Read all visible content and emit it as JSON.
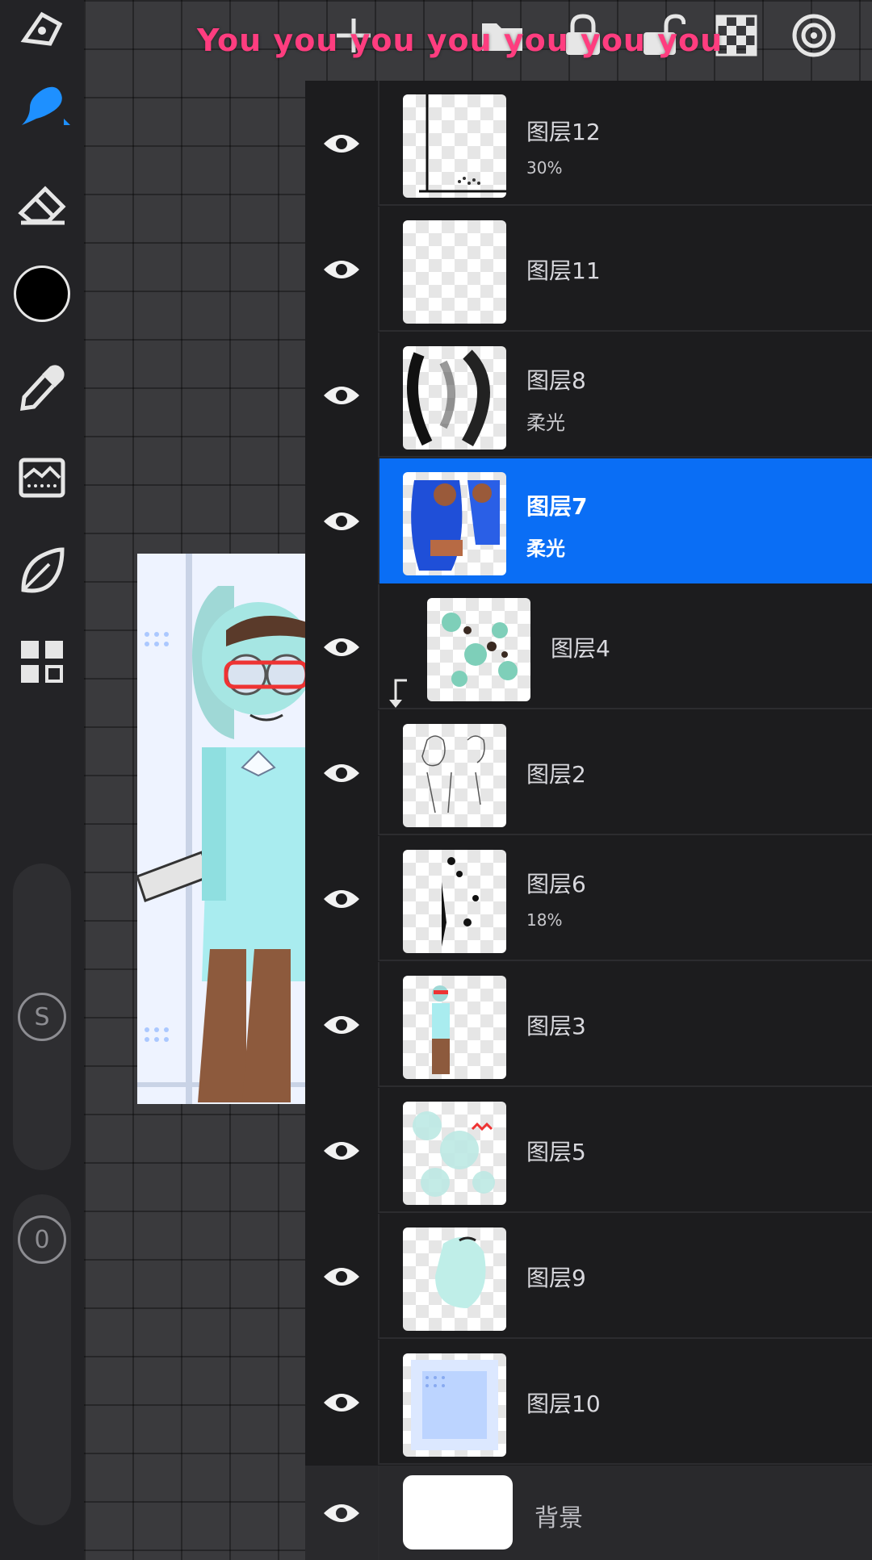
{
  "banner": {
    "text": "You you you you you you you"
  },
  "toolbar": {
    "tools": [
      "gallery-icon",
      "brush-icon",
      "eraser-icon",
      "color-swatch",
      "eyedropper-icon",
      "adjustments-icon",
      "smudge-leaf-icon",
      "layers-icon"
    ],
    "color": "#000000",
    "size_knob_label": "S",
    "opacity_knob_label": "0"
  },
  "top_actions": [
    "add-layer-icon",
    "folder-icon",
    "lock-icon",
    "unlock-icon",
    "checkerboard-icon",
    "target-icon"
  ],
  "layers": [
    {
      "name": "图层12",
      "sub": "30%"
    },
    {
      "name": "图层11",
      "sub": ""
    },
    {
      "name": "图层8",
      "sub": "柔光"
    },
    {
      "name": "图层7",
      "sub": "柔光",
      "selected": true
    },
    {
      "name": "图层4",
      "sub": "",
      "clipped": true
    },
    {
      "name": "图层2",
      "sub": ""
    },
    {
      "name": "图层6",
      "sub": "18%"
    },
    {
      "name": "图层3",
      "sub": ""
    },
    {
      "name": "图层5",
      "sub": ""
    },
    {
      "name": "图层9",
      "sub": ""
    },
    {
      "name": "图层10",
      "sub": ""
    }
  ],
  "background_layer": {
    "name": "背景"
  },
  "colors": {
    "accent": "#0a6ef5",
    "banner": "#ff3d7f",
    "brush_active": "#1e90ff"
  }
}
